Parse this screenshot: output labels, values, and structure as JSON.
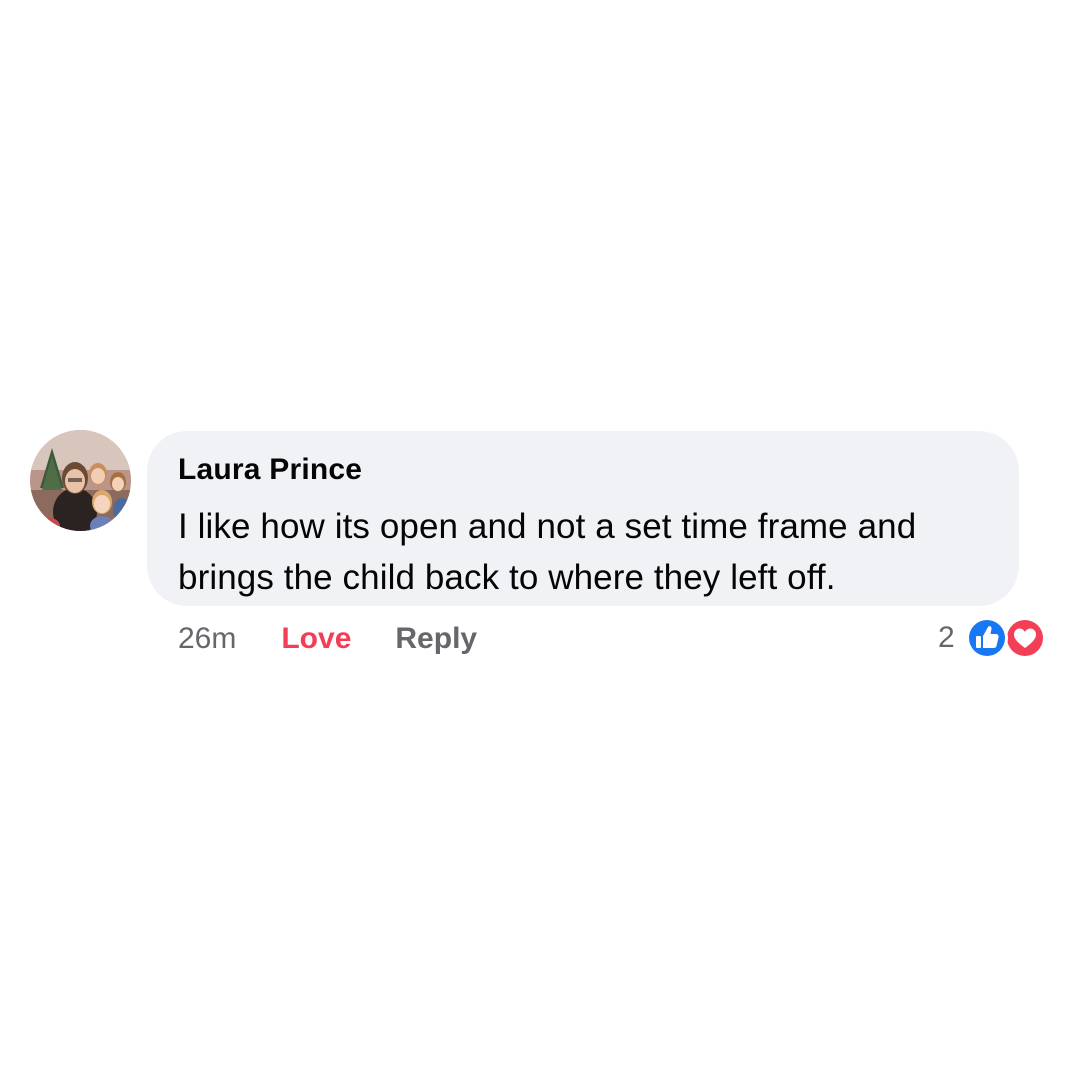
{
  "comment": {
    "author": "Laura Prince",
    "text": "I like how its open and not a set time frame and brings the child back to where they left off.",
    "avatar_icon": "profile-photo-avatar"
  },
  "actions": {
    "timestamp": "26m",
    "reaction_label": "Love",
    "reply_label": "Reply"
  },
  "reactions": {
    "count": "2",
    "icons": [
      "like-icon",
      "love-icon"
    ]
  },
  "colors": {
    "bubble": "#f0f2f5",
    "text": "#050505",
    "secondary": "#65676b",
    "love": "#f33e58",
    "like": "#1877f2"
  }
}
